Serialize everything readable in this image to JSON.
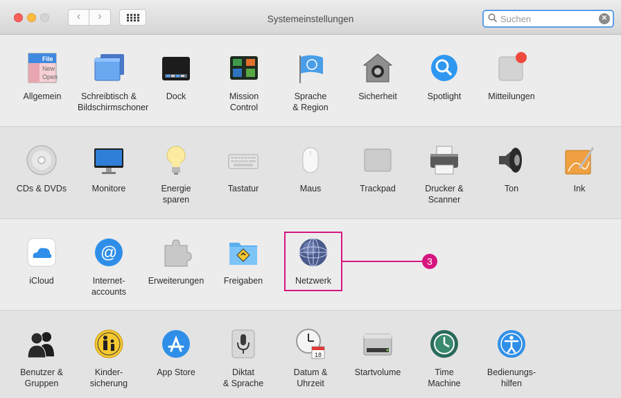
{
  "window": {
    "title": "Systemeinstellungen",
    "nav_back": "‹",
    "nav_forward": "›",
    "search_placeholder": "Suchen",
    "search_value": "",
    "search_clear": "✕"
  },
  "colors": {
    "highlight": "#d6157f",
    "search_focus": "#5a9ee8"
  },
  "callout": {
    "number": "3",
    "highlighted_item": "Netzwerk"
  },
  "sections": [
    {
      "items": [
        {
          "label": "Allgemein",
          "icon": "general-icon"
        },
        {
          "label": "Schreibtisch &\nBildschirmschoner",
          "icon": "desktop-icon"
        },
        {
          "label": "Dock",
          "icon": "dock-icon"
        },
        {
          "label": "Mission\nControl",
          "icon": "mission-control-icon"
        },
        {
          "label": "Sprache\n& Region",
          "icon": "language-region-icon"
        },
        {
          "label": "Sicherheit",
          "icon": "security-icon"
        },
        {
          "label": "Spotlight",
          "icon": "spotlight-icon"
        },
        {
          "label": "Mitteilungen",
          "icon": "notifications-icon"
        }
      ]
    },
    {
      "items": [
        {
          "label": "CDs & DVDs",
          "icon": "cd-dvd-icon"
        },
        {
          "label": "Monitore",
          "icon": "monitor-icon"
        },
        {
          "label": "Energie\nsparen",
          "icon": "energy-saver-icon"
        },
        {
          "label": "Tastatur",
          "icon": "keyboard-icon"
        },
        {
          "label": "Maus",
          "icon": "mouse-icon"
        },
        {
          "label": "Trackpad",
          "icon": "trackpad-icon"
        },
        {
          "label": "Drucker &\nScanner",
          "icon": "printer-icon"
        },
        {
          "label": "Ton",
          "icon": "sound-icon"
        },
        {
          "label": "Ink",
          "icon": "ink-icon"
        }
      ]
    },
    {
      "items": [
        {
          "label": "iCloud",
          "icon": "icloud-icon"
        },
        {
          "label": "Internet-\naccounts",
          "icon": "internet-accounts-icon"
        },
        {
          "label": "Erweiterungen",
          "icon": "extensions-icon"
        },
        {
          "label": "Freigaben",
          "icon": "sharing-icon"
        },
        {
          "label": "Netzwerk",
          "icon": "network-icon"
        }
      ]
    },
    {
      "items": [
        {
          "label": "Benutzer &\nGruppen",
          "icon": "users-groups-icon"
        },
        {
          "label": "Kinder-\nsicherung",
          "icon": "parental-controls-icon"
        },
        {
          "label": "App Store",
          "icon": "app-store-icon"
        },
        {
          "label": "Diktat\n& Sprache",
          "icon": "dictation-icon"
        },
        {
          "label": "Datum &\nUhrzeit",
          "icon": "date-time-icon"
        },
        {
          "label": "Startvolume",
          "icon": "startup-disk-icon"
        },
        {
          "label": "Time\nMachine",
          "icon": "time-machine-icon"
        },
        {
          "label": "Bedienungs-\nhilfen",
          "icon": "accessibility-icon"
        }
      ]
    }
  ],
  "icon_text": {
    "general_file": "File",
    "general_new": "New",
    "general_open": "Open",
    "calendar_day": "18"
  }
}
